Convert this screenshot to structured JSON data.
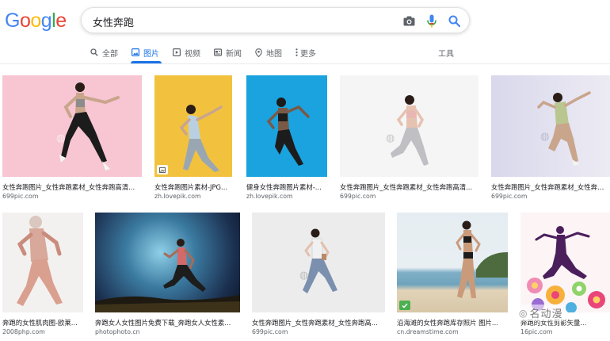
{
  "logo": "Google",
  "search": {
    "query": "女性奔跑"
  },
  "tabs": [
    {
      "label": "全部"
    },
    {
      "label": "图片"
    },
    {
      "label": "视频"
    },
    {
      "label": "新闻"
    },
    {
      "label": "地图"
    },
    {
      "label": "更多"
    }
  ],
  "tools_label": "工具",
  "results": [
    {
      "caption": "女性奔跑图片_女性奔跑素材_女性奔跑高清...",
      "source": "699pic.com"
    },
    {
      "caption": "女性奔跑图片素材-JPG...",
      "source": "zh.lovepik.com"
    },
    {
      "caption": "健身女性奔跑图片素材-...",
      "source": "zh.lovepik.com"
    },
    {
      "caption": "女性奔跑图片_女性奔跑素材_女性奔跑高清...",
      "source": "699pic.com"
    },
    {
      "caption": "女性奔跑图片_女性奔跑素材_女性奔跑...",
      "source": "699pic.com"
    },
    {
      "caption": "奔跑的女性肌肉图-欧莱...",
      "source": "2008php.com"
    },
    {
      "caption": "奔跑女人女性图片免费下载_奔跑女人女性素...",
      "source": "photophoto.cn"
    },
    {
      "caption": "女性奔跑图片_女性奔跑素材_女性奔跑高...",
      "source": "699pic.com"
    },
    {
      "caption": "沿海滩的女性奔跑库存照片 图片...",
      "source": "cn.dreamstime.com"
    },
    {
      "caption": "奔跑的女性剪影矢量...",
      "source": "16pic.com"
    }
  ],
  "overlay_watermark": "名动漫",
  "colors": {
    "accent": "#1a73e8",
    "pink_bg": "#f7c6d2",
    "yellow_bg": "#f2c23f",
    "cyan_bg": "#1aa3de",
    "white_bg": "#f5f5f5",
    "lavender_bg": "#dfdcec"
  }
}
